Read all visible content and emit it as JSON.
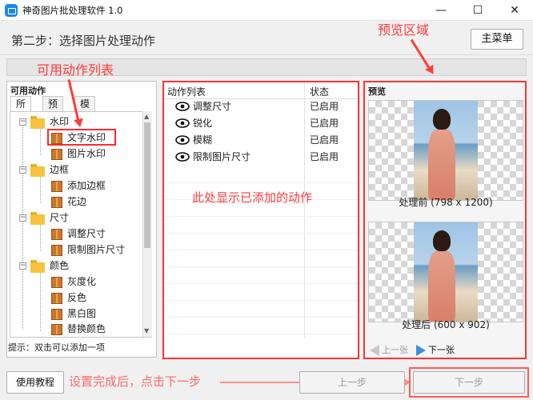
{
  "app": {
    "title": "神奇图片批处理软件 1.0",
    "icon": "app-image-icon"
  },
  "window_controls": {
    "minimize": "—",
    "maximize": "☐",
    "close": "✕"
  },
  "header": {
    "step_title": "第二步：选择图片处理动作",
    "main_menu_label": "主菜单"
  },
  "annotations": {
    "available_actions_list": "可用动作列表",
    "preview_area": "预览区域",
    "added_actions_hint": "此处显示已添加的动作",
    "footer_tip": "设置完成后，点击下一步"
  },
  "left_panel": {
    "caption": "可用动作",
    "tabs": [
      {
        "label": "所有"
      },
      {
        "label": "预设"
      },
      {
        "label": "模板"
      }
    ],
    "tree": [
      {
        "label": "水印",
        "type": "group"
      },
      {
        "label": "文字水印",
        "type": "item"
      },
      {
        "label": "图片水印",
        "type": "item"
      },
      {
        "label": "边框",
        "type": "group"
      },
      {
        "label": "添加边框",
        "type": "item"
      },
      {
        "label": "花边",
        "type": "item"
      },
      {
        "label": "尺寸",
        "type": "group"
      },
      {
        "label": "调整尺寸",
        "type": "item"
      },
      {
        "label": "限制图片尺寸",
        "type": "item"
      },
      {
        "label": "颜色",
        "type": "group"
      },
      {
        "label": "灰度化",
        "type": "item"
      },
      {
        "label": "反色",
        "type": "item"
      },
      {
        "label": "黑白图",
        "type": "item"
      },
      {
        "label": "替换颜色",
        "type": "item"
      }
    ],
    "hint": "提示：双击可以添加一项"
  },
  "action_list": {
    "col_actions": "动作列表",
    "col_status": "状态",
    "rows": [
      {
        "name": "调整尺寸",
        "status": "已启用"
      },
      {
        "name": "锐化",
        "status": "已启用"
      },
      {
        "name": "模糊",
        "status": "已启用"
      },
      {
        "name": "限制图片尺寸",
        "status": "已启用"
      }
    ]
  },
  "preview": {
    "caption": "预览",
    "before_label": "处理前 (798 x 1200)",
    "after_label": "处理后 (600 x 902)",
    "prev_label": "上一张",
    "next_label": "下一张"
  },
  "footer": {
    "tutorial_label": "使用教程",
    "prev_step_label": "上一步",
    "next_step_label": "下一步"
  },
  "colors": {
    "annotation_red": "#ff3b3b",
    "accent_blue": "#1e88e5"
  }
}
